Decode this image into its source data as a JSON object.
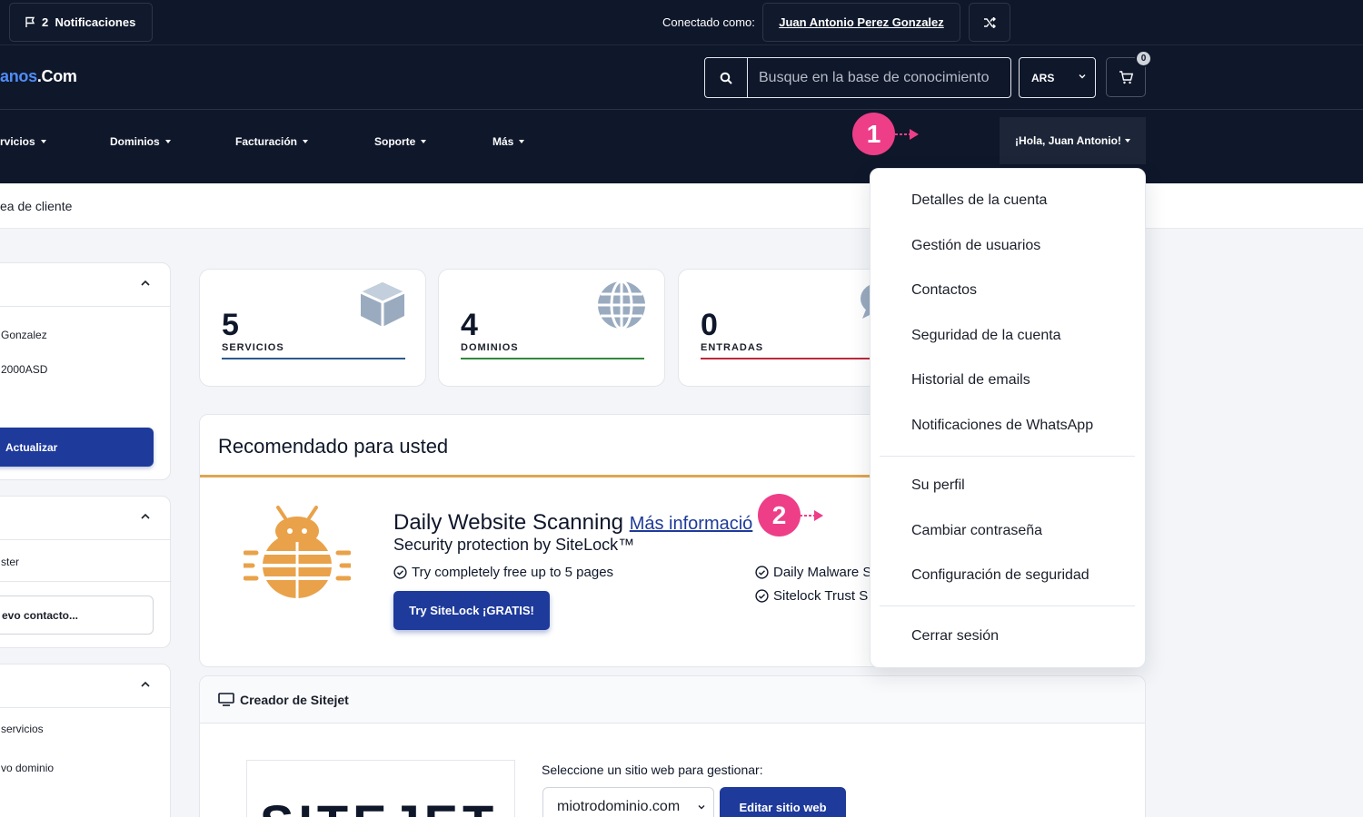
{
  "topbar": {
    "notifications_label": "2  Notificaciones",
    "connected_label": "Conectado como:",
    "user_name": "Juan Antonio Perez Gonzalez"
  },
  "header": {
    "logo_text": "anos",
    "logo_suffix": ".Com",
    "search_placeholder": "Busque en la base de conocimiento",
    "currency": "ARS",
    "cart_count": "0"
  },
  "nav": {
    "items": [
      "rvicios",
      "Dominios",
      "Facturación",
      "Soporte",
      "Más"
    ],
    "user_menu": "¡Hola, Juan Antonio!"
  },
  "breadcrumb": "ea de cliente",
  "sidebar": {
    "name_line": "Gonzalez",
    "code_line": "2000ASD",
    "update_button": "Actualizar",
    "contacts_line": "ster",
    "new_contact_button": "evo contacto...",
    "services_line": "servicios",
    "domain_line": "vo dominio"
  },
  "stats": [
    {
      "value": "5",
      "label": "SERVICIOS",
      "color": "#2b5a8c"
    },
    {
      "value": "4",
      "label": "DOMINIOS",
      "color": "#2f8a3a"
    },
    {
      "value": "0",
      "label": "ENTRADAS",
      "color": "#c0283a"
    }
  ],
  "recommended": {
    "title": "Recomendado para usted",
    "product_title": "Daily Website Scanning",
    "more_link": "Más informació",
    "subtitle": "Security protection by SiteLock™",
    "feature_1": "Try completely free up to 5 pages",
    "feature_2": "Daily Malware S",
    "feature_3": "Sitelock Trust S",
    "cta": "Try SiteLock ¡GRATIS!"
  },
  "sitejet": {
    "title": "Creador de Sitejet",
    "logo_text": "SITEJET",
    "select_label": "Seleccione un sitio web para gestionar:",
    "selected_domain": "miotrodominio.com",
    "edit_button": "Editar sitio web"
  },
  "dropdown": {
    "group1": [
      "Detalles de la cuenta",
      "Gestión de usuarios",
      "Contactos",
      "Seguridad de la cuenta",
      "Historial de emails",
      "Notificaciones de WhatsApp"
    ],
    "group2": [
      "Su perfil",
      "Cambiar contraseña",
      "Configuración de seguridad"
    ],
    "logout": "Cerrar sesión"
  },
  "markers": [
    "1",
    "2"
  ],
  "colors": {
    "navy": "#0f172a",
    "primary": "#1e3a9a",
    "marker": "#ee3e88",
    "accent": "#e0a54f"
  }
}
